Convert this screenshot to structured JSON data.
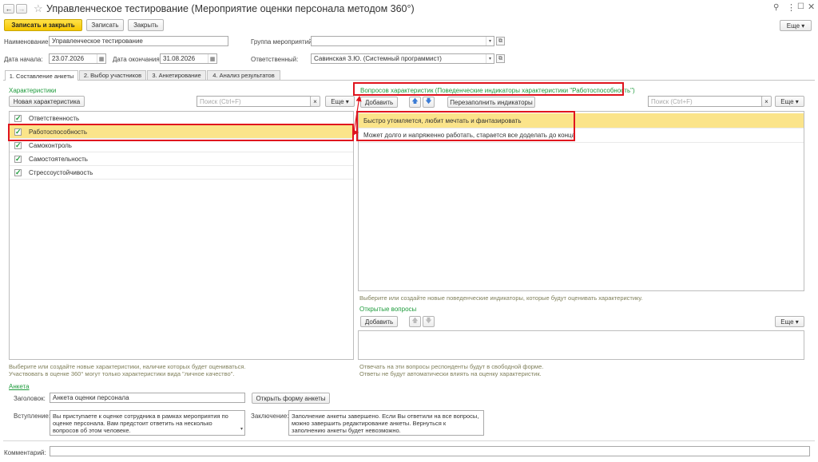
{
  "window": {
    "title": "Управленческое тестирование (Мероприятие оценки персонала методом 360°)"
  },
  "toolbar": {
    "save_close": "Записать и закрыть",
    "save": "Записать",
    "close": "Закрыть",
    "more": "Еще"
  },
  "form": {
    "name_label": "Наименование:",
    "name_value": "Управленческое тестирование",
    "group_label": "Группа мероприятий:",
    "group_value": "",
    "start_label": "Дата начала:",
    "start_value": "23.07.2026",
    "end_label": "Дата окончания:",
    "end_value": "31.08.2026",
    "resp_label": "Ответственный:",
    "resp_value": "Савинская З.Ю. (Системный программист)"
  },
  "tabs": [
    "1. Составление анкеты",
    "2. Выбор участников",
    "3. Анкетирование",
    "4. Анализ результатов"
  ],
  "left": {
    "title": "Характеристики",
    "new_button": "Новая характеристика",
    "search_placeholder": "Поиск (Ctrl+F)",
    "more": "Еще",
    "items": [
      {
        "label": "Ответственность",
        "checked": true
      },
      {
        "label": "Работоспособность",
        "checked": true
      },
      {
        "label": "Самоконтроль",
        "checked": true
      },
      {
        "label": "Самостоятельность",
        "checked": true
      },
      {
        "label": "Стрессоустойчивость",
        "checked": true
      }
    ],
    "hint": "Выберите или создайте новые характеристики, наличие которых будет оцениваться. Участвовать в оценке 360° могут только характеристики вида \"личное качество\"."
  },
  "right": {
    "title": "Вопросов характеристик (Поведенческие индикаторы характеристики \"Работоспособность\")",
    "add_button": "Добавить",
    "refill_button": "Перезаполнить индикаторы",
    "search_placeholder": "Поиск (Ctrl+F)",
    "more": "Еще",
    "items": [
      "Быстро утомляется, любит мечтать и фантазировать",
      "Может долго и напряженно работать, старается все доделать до конца"
    ],
    "hint": "Выберите или создайте новые поведенческие индикаторы, которые будут оценивать характеристику.",
    "open_title": "Открытые вопросы",
    "open_add": "Добавить",
    "open_more": "Еще",
    "open_hint": "Отвечать на эти вопросы респонденты будут в свободной форме. Ответы не будут автоматически влиять на оценку характеристик."
  },
  "survey": {
    "link": "Анкета",
    "header_label": "Заголовок:",
    "header_value": "Анкета оценки персонала",
    "open_form": "Открыть форму анкеты",
    "intro_label": "Вступление:",
    "intro_value": "Вы приступаете к оценке сотрудника в рамках мероприятия по оценке персонала. Вам предстоит ответить на несколько вопросов об этом человеке.",
    "concl_label": "Заключение:",
    "concl_value": "Заполнение анкеты завершено. Если Вы ответили на все вопросы, можно завершить редактирование анкеты. Вернуться к заполнению анкеты будет невозможно."
  },
  "comment": {
    "label": "Комментарий:",
    "value": ""
  },
  "colors": {
    "accent_yellow": "#f7c700",
    "selection": "#fbe48a",
    "green_text": "#1e9b3c",
    "annotation_red": "#e0141e"
  }
}
